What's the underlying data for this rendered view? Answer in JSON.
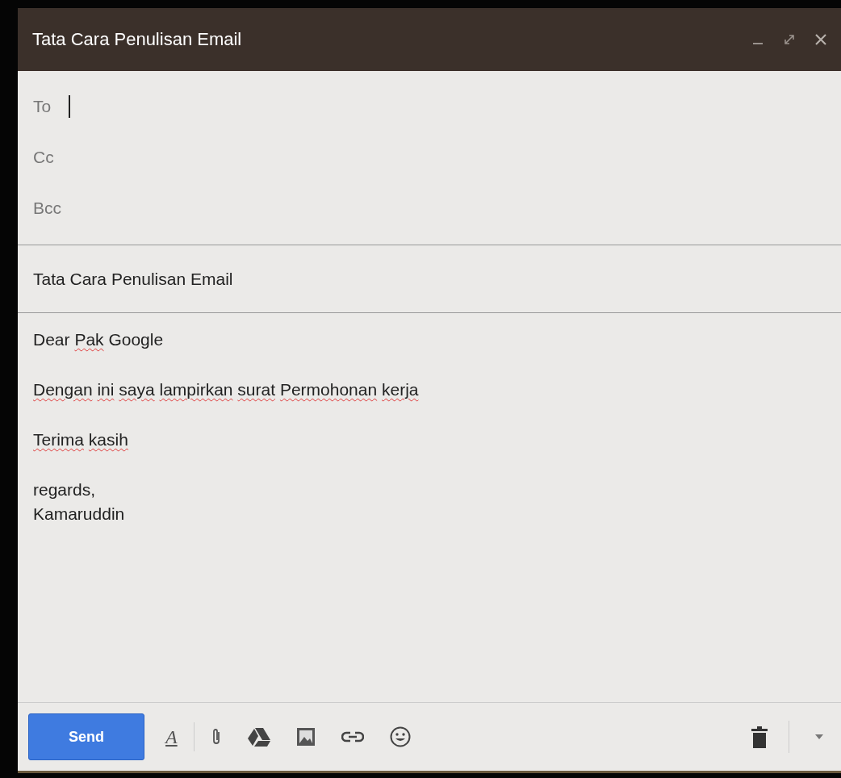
{
  "window": {
    "title": "Tata Cara Penulisan Email"
  },
  "recipients": [
    {
      "label": "To",
      "focused": true
    },
    {
      "label": "Cc",
      "focused": false
    },
    {
      "label": "Bcc",
      "focused": false
    }
  ],
  "subject": {
    "value": "Tata Cara Penulisan Email"
  },
  "body": {
    "paragraphs": [
      [
        {
          "text": "Dear",
          "misspelled": false
        },
        {
          "text": "Pak",
          "misspelled": true
        },
        {
          "text": "Google",
          "misspelled": false
        }
      ],
      [
        {
          "text": "Dengan",
          "misspelled": true
        },
        {
          "text": "ini",
          "misspelled": true
        },
        {
          "text": "saya",
          "misspelled": true
        },
        {
          "text": "lampirkan",
          "misspelled": true
        },
        {
          "text": "surat",
          "misspelled": true
        },
        {
          "text": "Permohonan",
          "misspelled": true
        },
        {
          "text": "kerja",
          "misspelled": true
        }
      ],
      [
        {
          "text": "Terima",
          "misspelled": true
        },
        {
          "text": "kasih",
          "misspelled": true
        }
      ],
      [
        {
          "text": "regards,\nKamaruddin",
          "misspelled": false
        }
      ]
    ]
  },
  "toolbar": {
    "send": "Send",
    "format": "A"
  }
}
